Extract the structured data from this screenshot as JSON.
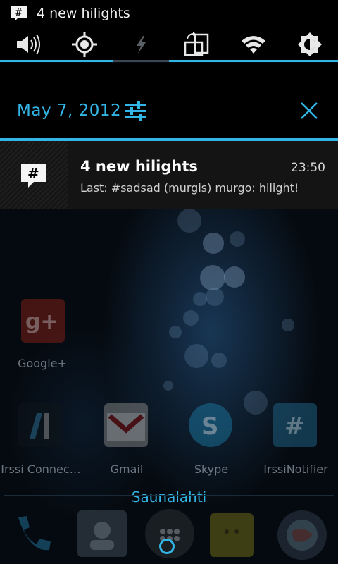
{
  "statusbar": {
    "title": "4 new hilights",
    "icon": "irssi-hash-icon"
  },
  "toggles": [
    {
      "name": "sound-icon",
      "state": "on"
    },
    {
      "name": "gps-icon",
      "state": "on"
    },
    {
      "name": "flash-icon",
      "state": "off"
    },
    {
      "name": "auto-rotate-icon",
      "state": "on"
    },
    {
      "name": "wifi-icon",
      "state": "on"
    },
    {
      "name": "brightness-icon",
      "state": "on"
    }
  ],
  "header": {
    "date": "May 7, 2012"
  },
  "notification": {
    "title": "4 new hilights",
    "time": "23:50",
    "text": "Last: #sadsad (murgis) murgo: hilight!",
    "icon": "irssi-hash-icon"
  },
  "home": {
    "apps": [
      {
        "label": "Google+"
      },
      {
        "label": "Irssi Connec…"
      },
      {
        "label": "Gmail"
      },
      {
        "label": "Skype"
      },
      {
        "label": "IrssiNotifier"
      }
    ],
    "carrier": "Saunalahti"
  },
  "colors": {
    "accent": "#33b5e5",
    "background": "#000000",
    "notification_bg": "#141414"
  }
}
